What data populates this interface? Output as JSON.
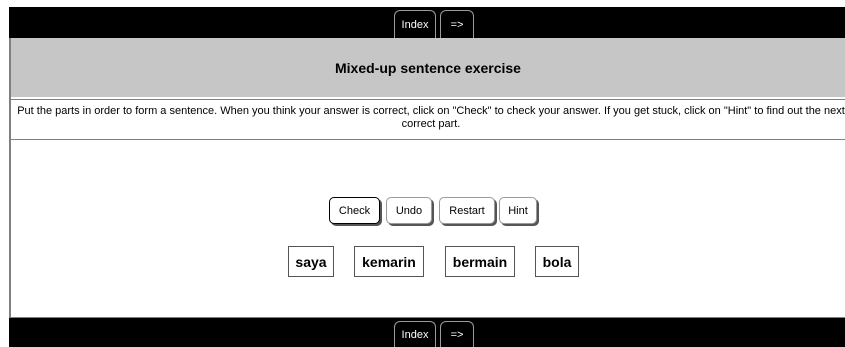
{
  "nav": {
    "index_label": "Index",
    "next_label": "=>"
  },
  "title": "Mixed-up sentence exercise",
  "instructions": "Put the parts in order to form a sentence. When you think your answer is correct, click on \"Check\" to check your answer. If you get stuck, click on \"Hint\" to find out the next correct part.",
  "controls": {
    "check": "Check",
    "undo": "Undo",
    "restart": "Restart",
    "hint": "Hint"
  },
  "words": [
    "saya",
    "kemarin",
    "bermain",
    "bola"
  ]
}
